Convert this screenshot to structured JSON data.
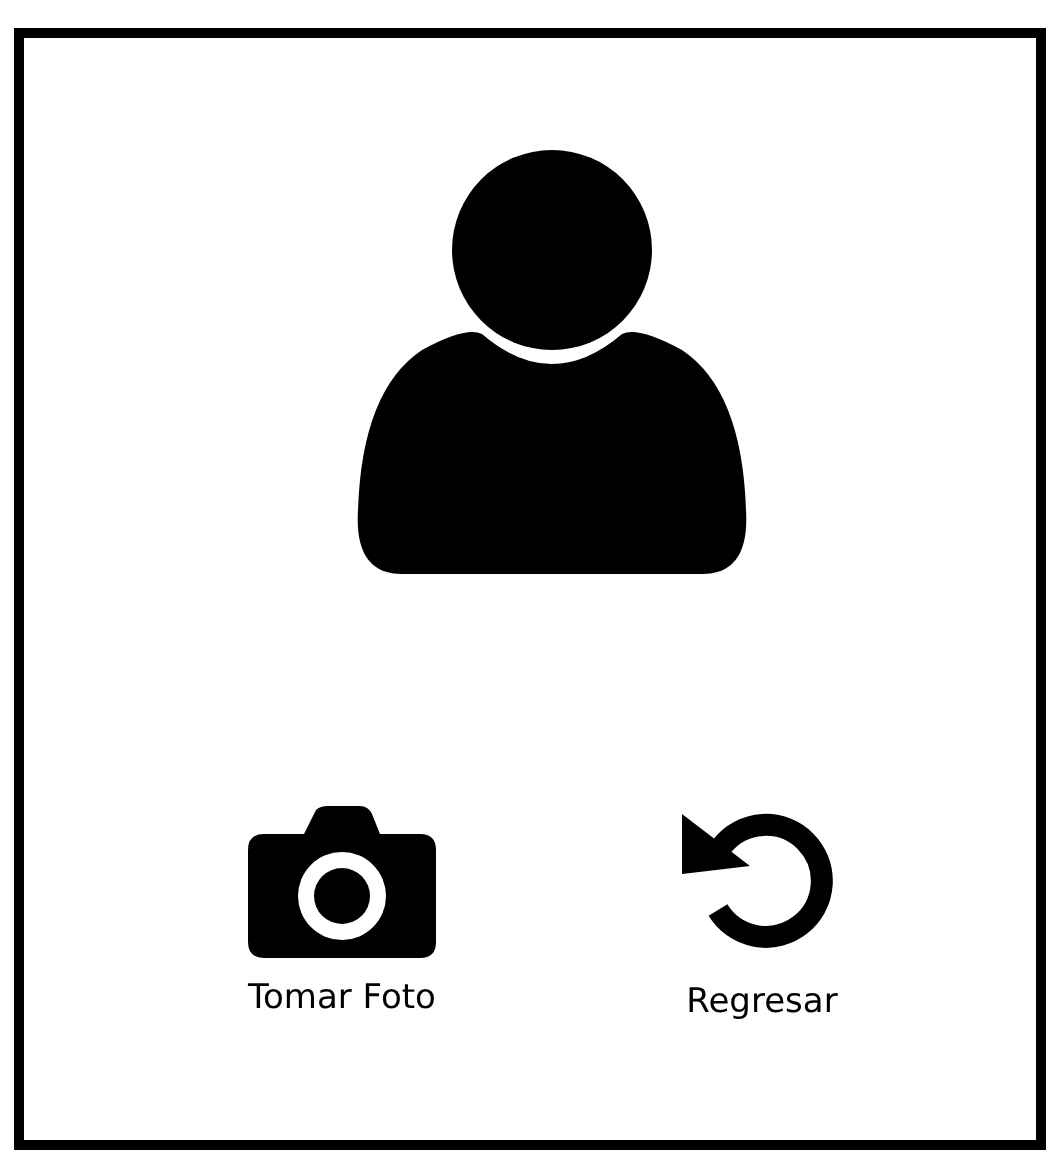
{
  "actions": [
    {
      "kind": "camera",
      "label": "Tomar Foto"
    },
    {
      "kind": "back",
      "label": "Regresar"
    }
  ]
}
